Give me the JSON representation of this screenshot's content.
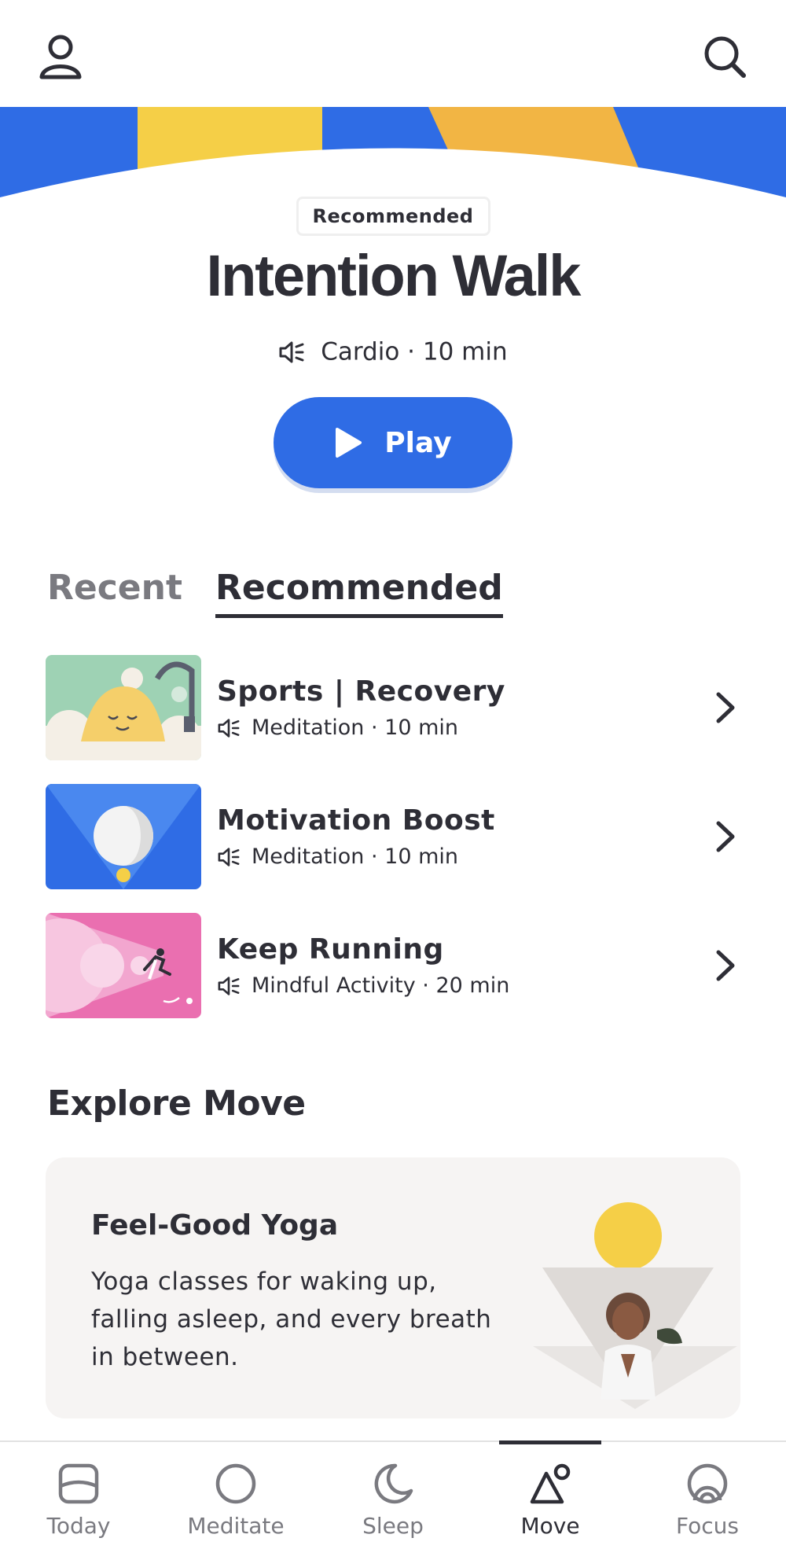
{
  "header": {
    "profile_icon": "person-icon",
    "search_icon": "search-icon"
  },
  "banner": {
    "colors": [
      "#2f6ce5",
      "#f5cf47",
      "#f2b544"
    ]
  },
  "hero": {
    "badge": "Recommended",
    "title": "Intention Walk",
    "meta": "Cardio · 10 min",
    "meta_icon": "speaker-icon",
    "play_label": "Play",
    "play_icon": "play-icon",
    "accent": "#2f6ce5"
  },
  "tabs": [
    {
      "label": "Recent",
      "active": false
    },
    {
      "label": "Recommended",
      "active": true
    }
  ],
  "list": [
    {
      "title": "Sports | Recovery",
      "meta": "Meditation · 10 min"
    },
    {
      "title": "Motivation Boost",
      "meta": "Meditation · 10 min"
    },
    {
      "title": "Keep Running",
      "meta": "Mindful Activity · 20 min"
    }
  ],
  "explore": {
    "section_title": "Explore Move",
    "card": {
      "title": "Feel-Good Yoga",
      "description": "Yoga classes for waking up, falling asleep, and every breath in between."
    }
  },
  "bottom_nav": [
    {
      "label": "Today",
      "icon": "today-icon",
      "active": false
    },
    {
      "label": "Meditate",
      "icon": "meditate-icon",
      "active": false
    },
    {
      "label": "Sleep",
      "icon": "moon-icon",
      "active": false
    },
    {
      "label": "Move",
      "icon": "move-icon",
      "active": true
    },
    {
      "label": "Focus",
      "icon": "focus-icon",
      "active": false
    }
  ]
}
